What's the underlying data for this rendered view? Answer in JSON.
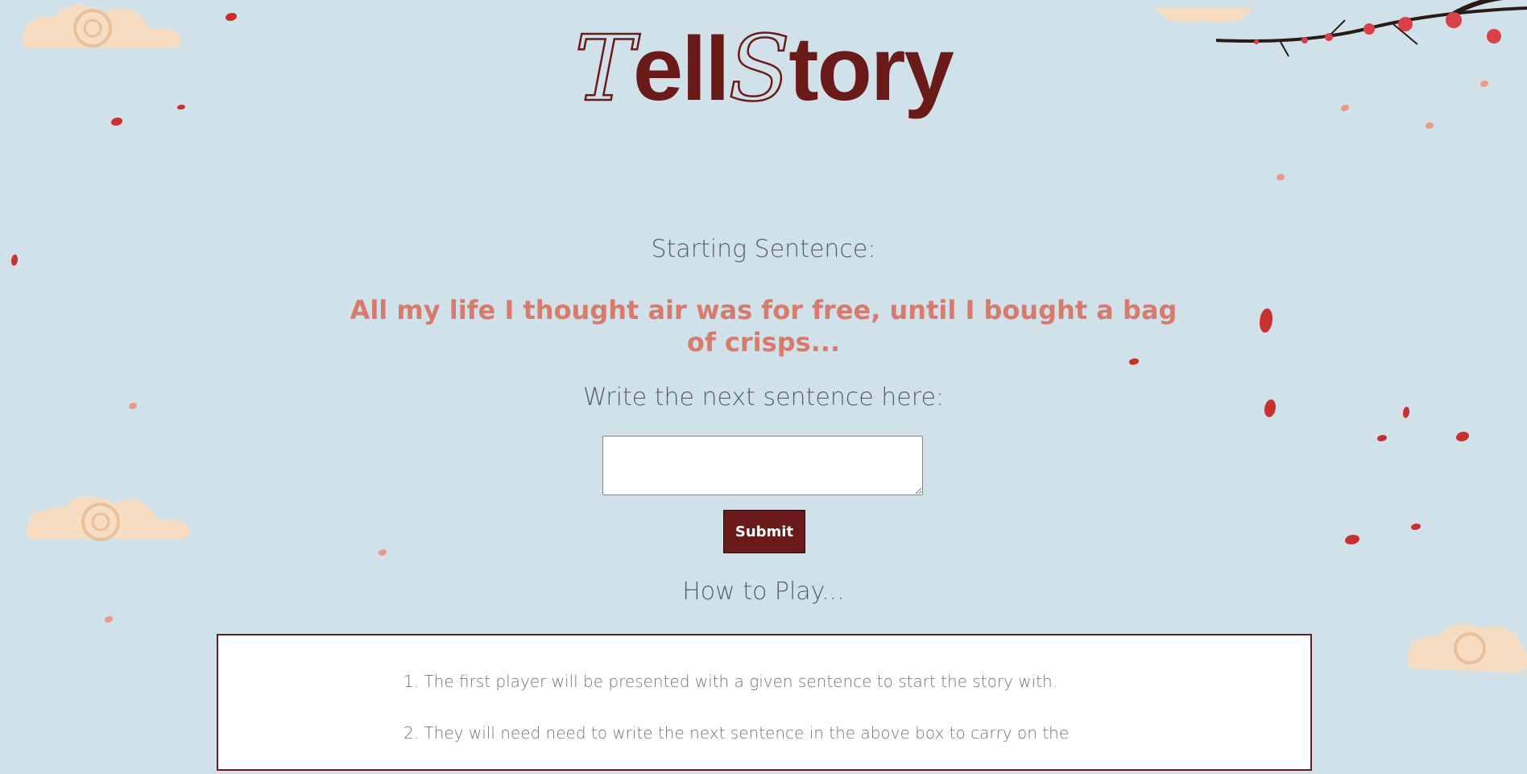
{
  "logo": {
    "part1": "T",
    "part2": "ell",
    "part3": "S",
    "part4": "tory"
  },
  "game": {
    "starting_label": "Starting Sentence:",
    "starting_sentence": "All my life I thought air was for free, until I bought a bag of crisps...",
    "write_label": "Write the next sentence here:",
    "sentence_value": "",
    "submit_label": "Submit"
  },
  "howto": {
    "title": "How to Play...",
    "rules": [
      "1. The first player will be presented with a given sentence to start the story with.",
      "2. They will need need to write the next sentence in the above box to carry on the"
    ]
  },
  "colors": {
    "background": "#d0e1e9",
    "brand": "#6b1a1a",
    "sentence": "#d77b6c",
    "petal": "#c8312f"
  }
}
